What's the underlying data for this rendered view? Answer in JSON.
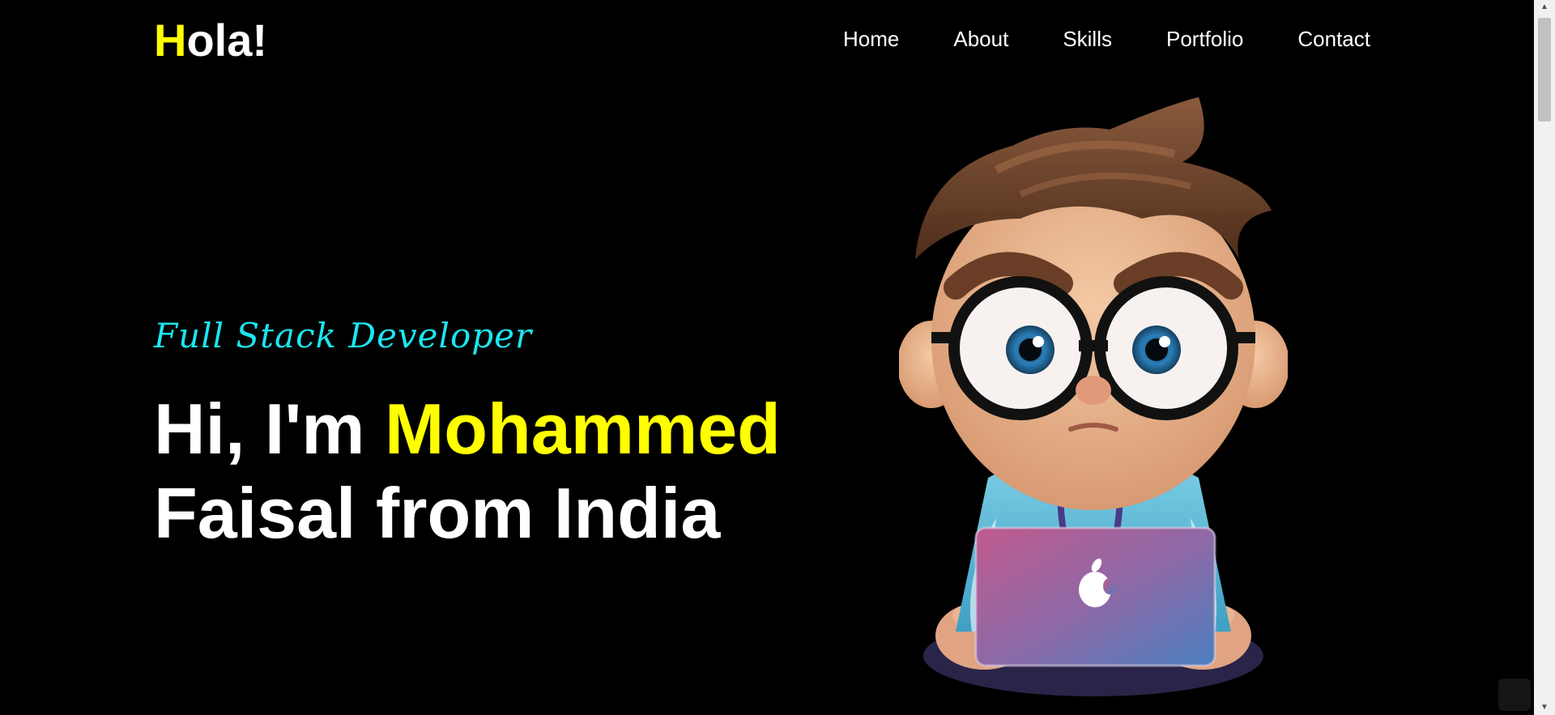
{
  "header": {
    "logo_accent": "H",
    "logo_rest": "ola!",
    "nav": [
      "Home",
      "About",
      "Skills",
      "Portfolio",
      "Contact"
    ]
  },
  "hero": {
    "role": "Full Stack Developer",
    "greeting": "Hi, I'm ",
    "name_highlight": "Mohammed",
    "rest": "Faisal from India"
  },
  "colors": {
    "background": "#000000",
    "accent_yellow": "#ffff00",
    "accent_cyan": "#1be6f0",
    "text": "#ffffff"
  }
}
